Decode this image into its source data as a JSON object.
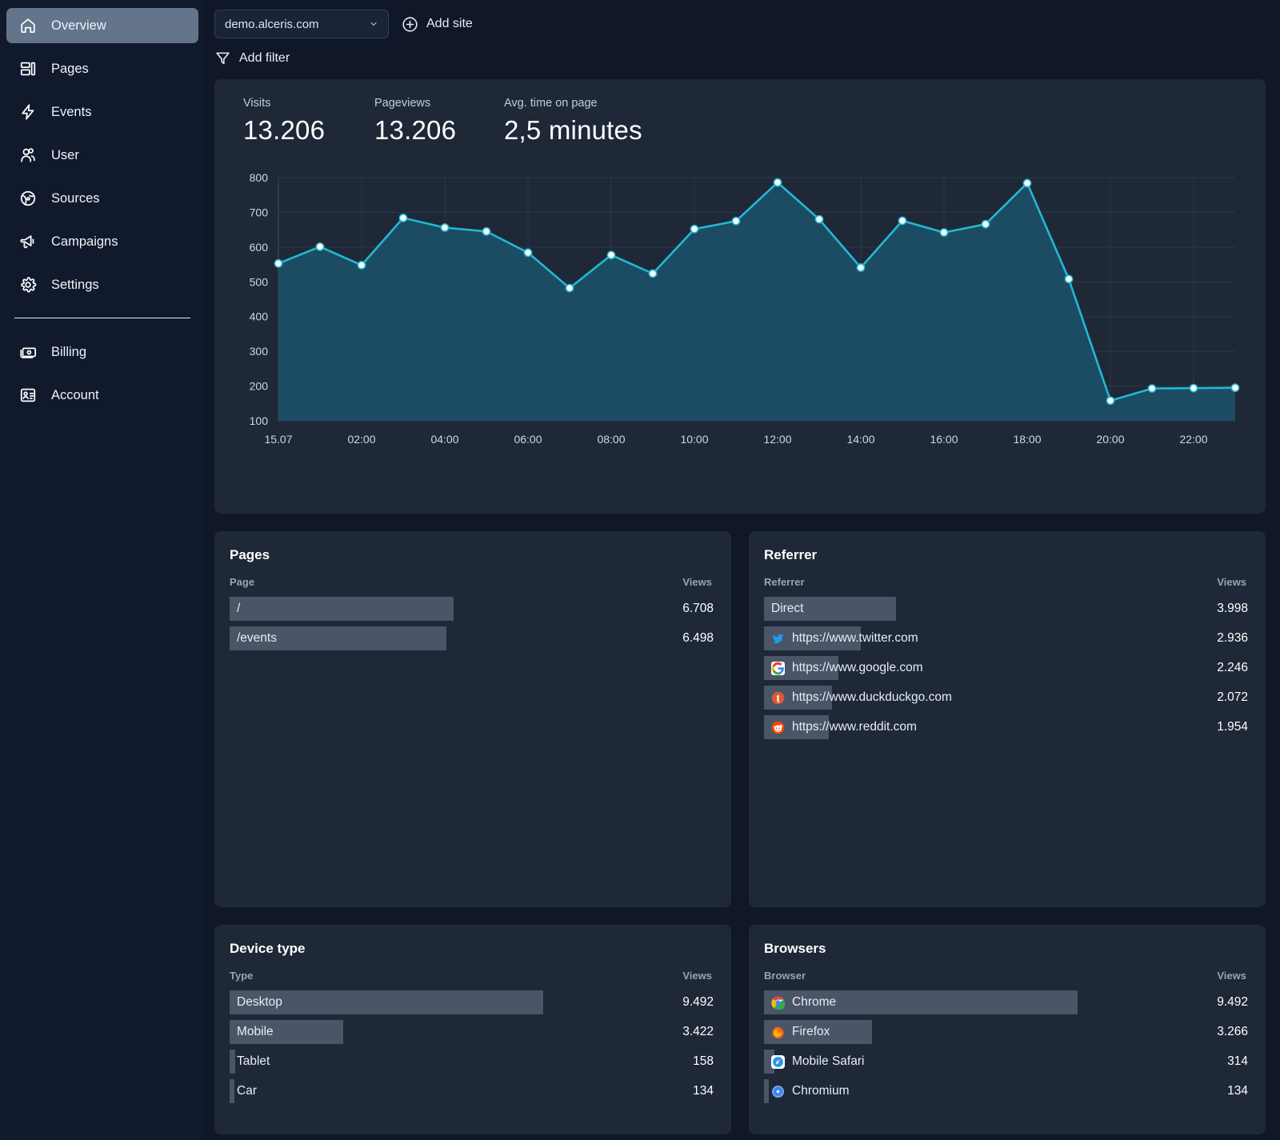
{
  "sidebar": {
    "items": [
      {
        "label": "Overview",
        "icon": "home-icon",
        "active": true
      },
      {
        "label": "Pages",
        "icon": "layout-icon",
        "active": false
      },
      {
        "label": "Events",
        "icon": "bolt-icon",
        "active": false
      },
      {
        "label": "User",
        "icon": "users-icon",
        "active": false
      },
      {
        "label": "Sources",
        "icon": "globe-icon",
        "active": false
      },
      {
        "label": "Campaigns",
        "icon": "megaphone-icon",
        "active": false
      },
      {
        "label": "Settings",
        "icon": "gear-icon",
        "active": false
      }
    ],
    "bottom_items": [
      {
        "label": "Billing",
        "icon": "banknote-icon"
      },
      {
        "label": "Account",
        "icon": "id-card-icon"
      }
    ]
  },
  "topbar": {
    "site_selected": "demo.alceris.com",
    "add_site_label": "Add site",
    "add_filter_label": "Add filter"
  },
  "stats": [
    {
      "label": "Visits",
      "value": "13.206"
    },
    {
      "label": "Pageviews",
      "value": "13.206"
    },
    {
      "label": "Avg. time on page",
      "value": "2,5 minutes"
    }
  ],
  "chart_data": {
    "type": "area",
    "title": "",
    "xlabel": "",
    "ylabel": "",
    "ylim": [
      100,
      800
    ],
    "yticks": [
      100,
      200,
      300,
      400,
      500,
      600,
      700,
      800
    ],
    "grid": true,
    "legend": false,
    "line_color": "#22b8d4",
    "fill_color": "#1c4c63",
    "marker_color": "#ffffff",
    "x": [
      "15.07",
      "01:00",
      "02:00",
      "03:00",
      "04:00",
      "05:00",
      "06:00",
      "07:00",
      "08:00",
      "09:00",
      "10:00",
      "11:00",
      "12:00",
      "13:00",
      "14:00",
      "15:00",
      "16:00",
      "17:00",
      "18:00",
      "19:00",
      "20:00",
      "21:00",
      "22:00",
      "23:00"
    ],
    "xtick_labels": [
      "15.07",
      "02:00",
      "04:00",
      "06:00",
      "08:00",
      "10:00",
      "12:00",
      "14:00",
      "16:00",
      "18:00",
      "20:00",
      "22:00"
    ],
    "values": [
      553,
      601,
      548,
      684,
      656,
      645,
      584,
      482,
      577,
      524,
      652,
      675,
      786,
      680,
      541,
      676,
      642,
      666,
      784,
      508,
      158,
      193,
      194,
      195
    ]
  },
  "pages_panel": {
    "title": "Pages",
    "col_name": "Page",
    "col_value": "Views",
    "rows": [
      {
        "name": "/",
        "value": "6.708",
        "pct": 100
      },
      {
        "name": "/events",
        "value": "6.498",
        "pct": 96.9
      }
    ]
  },
  "referrer_panel": {
    "title": "Referrer",
    "col_name": "Referrer",
    "col_value": "Views",
    "rows": [
      {
        "name": "Direct",
        "value": "3.998",
        "pct": 100,
        "icon": ""
      },
      {
        "name": "https://www.twitter.com",
        "value": "2.936",
        "pct": 73.4,
        "icon": "twitter-icon"
      },
      {
        "name": "https://www.google.com",
        "value": "2.246",
        "pct": 56.2,
        "icon": "google-icon"
      },
      {
        "name": "https://www.duckduckgo.com",
        "value": "2.072",
        "pct": 51.8,
        "icon": "duckduckgo-icon"
      },
      {
        "name": "https://www.reddit.com",
        "value": "1.954",
        "pct": 48.9,
        "icon": "reddit-icon"
      }
    ]
  },
  "device_panel": {
    "title": "Device type",
    "col_name": "Type",
    "col_value": "Views",
    "rows": [
      {
        "name": "Desktop",
        "value": "9.492",
        "pct": 100
      },
      {
        "name": "Mobile",
        "value": "3.422",
        "pct": 36.1
      },
      {
        "name": "Tablet",
        "value": "158",
        "pct": 1.7
      },
      {
        "name": "Car",
        "value": "134",
        "pct": 1.4
      }
    ]
  },
  "browsers_panel": {
    "title": "Browsers",
    "col_name": "Browser",
    "col_value": "Views",
    "rows": [
      {
        "name": "Chrome",
        "value": "9.492",
        "pct": 100,
        "icon": "chrome-icon"
      },
      {
        "name": "Firefox",
        "value": "3.266",
        "pct": 34.4,
        "icon": "firefox-icon"
      },
      {
        "name": "Mobile Safari",
        "value": "314",
        "pct": 3.3,
        "icon": "safari-icon"
      },
      {
        "name": "Chromium",
        "value": "134",
        "pct": 1.4,
        "icon": "chromium-icon"
      }
    ]
  }
}
